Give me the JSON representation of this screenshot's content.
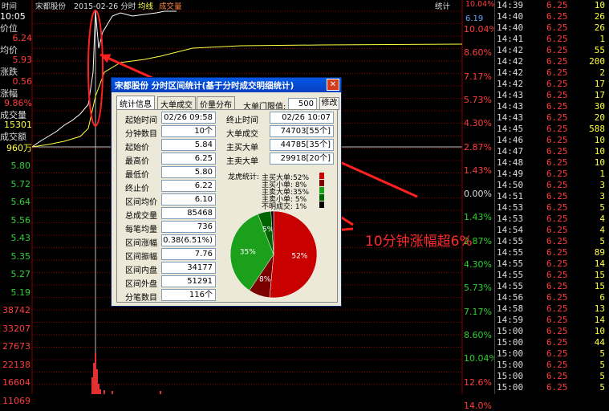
{
  "header": {
    "time_label": "时间",
    "stock_name": "宋都股份",
    "date_label": "2015-02-26 分时",
    "avg_label": "均线",
    "vol_label": "成交量",
    "stats_label": "统计",
    "top_pct": "10.04%",
    "top_price": "6.19"
  },
  "left_panel": {
    "time": "10:05",
    "price_label": "价位",
    "price": "6.24",
    "avg_label": "均价",
    "avg": "5.93",
    "change_label": "涨跌",
    "change": "0.56",
    "pct_label": "涨幅",
    "pct": "9.86%",
    "vol_label": "成交量",
    "vol": "15301",
    "amount_label": "成交额",
    "amount": "960万"
  },
  "left_ticks": [
    "5.80",
    "5.72",
    "5.64",
    "5.56",
    "5.43",
    "5.35",
    "5.27",
    "5.19",
    "38742",
    "33207",
    "27673",
    "22138",
    "16604",
    "11069"
  ],
  "right_ticks": [
    "10.04%",
    "8.60%",
    "7.17%",
    "5.73%",
    "4.30%",
    "2.87%",
    "1.43%",
    "0.00%",
    "1.43%",
    "2.87%",
    "4.30%",
    "5.73%",
    "7.17%",
    "8.60%",
    "10.04%",
    "12.6%",
    "14.0%"
  ],
  "trades": [
    [
      "14:39",
      "6.25",
      "10"
    ],
    [
      "14:40",
      "6.25",
      "26"
    ],
    [
      "14:40",
      "6.25",
      "26"
    ],
    [
      "14:41",
      "6.25",
      "1"
    ],
    [
      "14:42",
      "6.25",
      "55"
    ],
    [
      "14:42",
      "6.25",
      "200"
    ],
    [
      "14:42",
      "6.25",
      "2"
    ],
    [
      "14:42",
      "6.25",
      "17"
    ],
    [
      "14:43",
      "6.25",
      "17"
    ],
    [
      "14:43",
      "6.25",
      "30"
    ],
    [
      "14:43",
      "6.25",
      "20"
    ],
    [
      "14:45",
      "6.25",
      "588"
    ],
    [
      "14:46",
      "6.25",
      "10"
    ],
    [
      "14:47",
      "6.25",
      "10"
    ],
    [
      "14:48",
      "6.25",
      "10"
    ],
    [
      "14:49",
      "6.25",
      "1"
    ],
    [
      "14:50",
      "6.25",
      "3"
    ],
    [
      "14:51",
      "6.25",
      "3"
    ],
    [
      "14:53",
      "6.25",
      "5"
    ],
    [
      "14:53",
      "6.25",
      "4"
    ],
    [
      "14:54",
      "6.25",
      "4"
    ],
    [
      "14:55",
      "6.25",
      "5"
    ],
    [
      "14:55",
      "6.25",
      "89"
    ],
    [
      "14:55",
      "6.25",
      "14"
    ],
    [
      "14:55",
      "6.25",
      "15"
    ],
    [
      "14:55",
      "6.25",
      "15"
    ],
    [
      "14:56",
      "6.25",
      "6"
    ],
    [
      "14:58",
      "6.25",
      "13"
    ],
    [
      "14:59",
      "6.25",
      "14"
    ],
    [
      "15:00",
      "6.25",
      "10"
    ],
    [
      "15:00",
      "6.25",
      "44"
    ],
    [
      "15:00",
      "6.25",
      "5"
    ],
    [
      "15:00",
      "6.25",
      "5"
    ],
    [
      "15:00",
      "6.25",
      "5"
    ],
    [
      "15:00",
      "6.25",
      "5"
    ]
  ],
  "dialog": {
    "title": "宋都股份  分时区间统计(基于分时成交明细统计)",
    "close": "✕",
    "tabs": [
      "统计信息",
      "大单成交",
      "价量分布"
    ],
    "threshold_label": "大单门限值:",
    "threshold_value": "500",
    "modify_button": "修改",
    "fields": [
      {
        "label": "起始时间",
        "value": "02/26 09:58"
      },
      {
        "label": "分钟数目",
        "value": "10个"
      },
      {
        "label": "起始价",
        "value": "5.84"
      },
      {
        "label": "最高价",
        "value": "6.25"
      },
      {
        "label": "最低价",
        "value": "5.80"
      },
      {
        "label": "终止价",
        "value": "6.22"
      },
      {
        "label": "区间均价",
        "value": "6.10"
      },
      {
        "label": "总成交量",
        "value": "85468"
      },
      {
        "label": "每笔均量",
        "value": "736"
      },
      {
        "label": "区间涨幅",
        "value": "0.38(6.51%)"
      },
      {
        "label": "区间振幅",
        "value": "7.76"
      },
      {
        "label": "区间内盘",
        "value": "34177"
      },
      {
        "label": "区间外盘",
        "value": "51291"
      },
      {
        "label": "分笔数目",
        "value": "116个"
      }
    ],
    "right_fields": [
      {
        "label": "终止时间",
        "value": "02/26 10:07"
      },
      {
        "label": "大单成交",
        "value": "74703[55个]"
      },
      {
        "label": "主买大单",
        "value": "44785[35个]"
      },
      {
        "label": "主卖大单",
        "value": "29918[20个]"
      }
    ],
    "legend_title": "龙虎统计:",
    "legend": [
      {
        "label": "主买大单:52%",
        "color": "#c80000"
      },
      {
        "label": "主买小单: 8%",
        "color": "#7a0000"
      },
      {
        "label": "主卖大单:35%",
        "color": "#1aa01a"
      },
      {
        "label": "主卖小单: 5%",
        "color": "#006400"
      },
      {
        "label": "不明成交: 1%",
        "color": "#000000"
      }
    ],
    "pie": [
      52,
      8,
      35,
      5,
      1
    ],
    "pie_labels": [
      "52%",
      "8%",
      "35%",
      "5%",
      ""
    ]
  },
  "annotation": "10分钟涨幅超6%"
}
